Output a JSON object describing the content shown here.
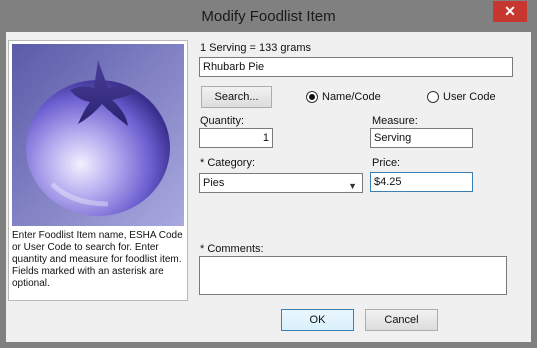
{
  "window": {
    "title": "Modify Foodlist Item",
    "close_glyph": "✕"
  },
  "help": {
    "text": "Enter Foodlist Item name, ESHA Code or User Code to search for. Enter quantity and measure for foodlist item. Fields marked with an asterisk are optional."
  },
  "serving": {
    "text": "1 Serving =  133 grams"
  },
  "name_field": {
    "value": "Rhubarb Pie"
  },
  "search": {
    "button_label": "Search...",
    "mode_name_code_label": "Name/Code",
    "mode_user_code_label": "User Code",
    "selected_mode": "Name/Code"
  },
  "quantity": {
    "label": "Quantity:",
    "value": "1"
  },
  "measure": {
    "label": "Measure:",
    "value": "Serving"
  },
  "category": {
    "label": "* Category:",
    "selected": "Pies"
  },
  "price": {
    "label": "Price:",
    "value": "$4.25"
  },
  "comments": {
    "label": "* Comments:",
    "value": ""
  },
  "buttons": {
    "ok_label": "OK",
    "cancel_label": "Cancel"
  },
  "icons": {
    "side_image": "plum-fruit-icon"
  },
  "colors": {
    "titlebar": "#808080",
    "close_button": "#c7372f",
    "dialog_bg": "#f0f0f0",
    "image_bg": "#7f7fc0",
    "fruit": "#6a5acd"
  }
}
